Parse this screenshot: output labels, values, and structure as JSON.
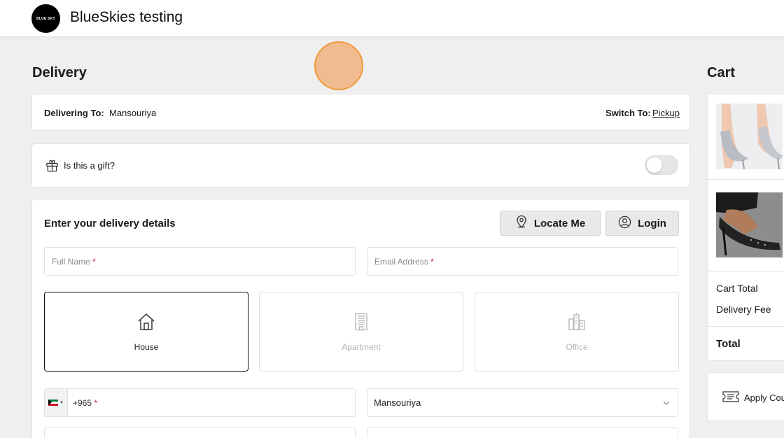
{
  "header": {
    "logo_text": "BLUE SKY",
    "brand": "BlueSkies testing"
  },
  "delivery": {
    "title": "Delivery",
    "delivering_to_label": "Delivering To:",
    "delivering_to_value": "Mansouriya",
    "switch_to_label": "Switch To:",
    "switch_to_link": "Pickup"
  },
  "gift": {
    "label": "Is this a gift?",
    "enabled": false
  },
  "details": {
    "title": "Enter your delivery details",
    "locate_me": "Locate Me",
    "login": "Login",
    "full_name_placeholder": "Full Name",
    "email_placeholder": "Email Address",
    "required_mark": "*",
    "address_types": [
      {
        "label": "House",
        "selected": true
      },
      {
        "label": "Apartment",
        "selected": false
      },
      {
        "label": "Office",
        "selected": false
      }
    ],
    "phone_code": "+965",
    "area_value": "Mansouriya"
  },
  "cart": {
    "title": "Cart",
    "cart_total_label": "Cart Total",
    "delivery_fee_label": "Delivery Fee",
    "total_label": "Total",
    "coupon_label": "Apply Cou"
  },
  "colors": {
    "background": "#efefef",
    "card": "#ffffff",
    "required": "#c0262d",
    "cursor_highlight": "#f09a3a"
  }
}
